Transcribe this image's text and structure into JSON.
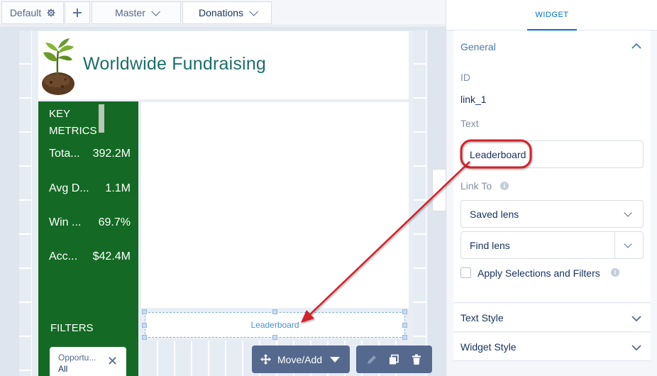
{
  "tabs": {
    "default_label": "Default",
    "master_label": "Master",
    "donations_label": "Donations"
  },
  "dashboard": {
    "title": "Worldwide Fundraising",
    "metrics_heading": "KEY METRICS",
    "metrics": [
      {
        "label": "Tota...",
        "value": "392.2M"
      },
      {
        "label": "Avg D...",
        "value": "1.1M"
      },
      {
        "label": "Win ...",
        "value": "69.7%"
      },
      {
        "label": "Acc...",
        "value": "$42.4M"
      }
    ],
    "filters_label": "FILTERS",
    "filter": {
      "label": "Opportu...",
      "value": "All"
    },
    "link_widget_text": "Leaderboard"
  },
  "toolbar": {
    "move_add_label": "Move/Add"
  },
  "panel": {
    "tab_label": "WIDGET",
    "general_title": "General",
    "id_label": "ID",
    "id_value": "link_1",
    "text_label": "Text",
    "text_value": "Leaderboard",
    "link_to_label": "Link To",
    "link_type_value": "Saved lens",
    "find_lens_value": "Find lens",
    "apply_label": "Apply Selections and Filters",
    "text_style_title": "Text Style",
    "widget_style_title": "Widget Style"
  },
  "colors": {
    "accent": "#0070d2",
    "metrics_bg": "#146a24",
    "title_teal": "#1b6e6a",
    "annotation_red": "#d2202c"
  }
}
